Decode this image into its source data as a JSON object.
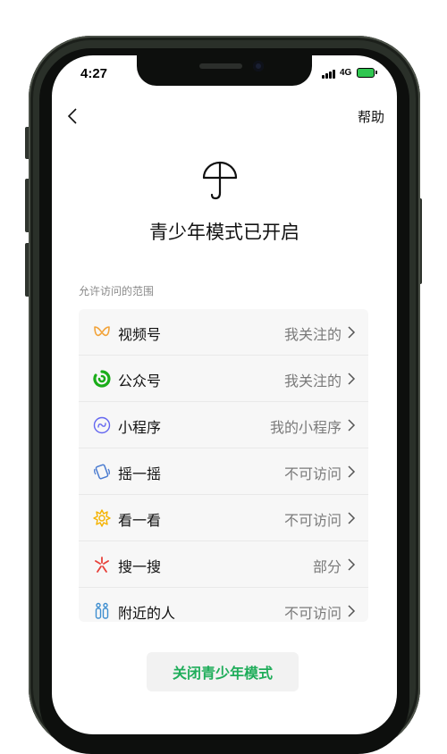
{
  "status_bar": {
    "time": "4:27",
    "network": "4G"
  },
  "nav": {
    "help_label": "帮助"
  },
  "hero": {
    "title": "青少年模式已开启"
  },
  "section_label": "允许访问的范围",
  "list_items": [
    {
      "label": "视频号",
      "value": "我关注的",
      "icon": "channels-icon",
      "color": "#f2a33a"
    },
    {
      "label": "公众号",
      "value": "我关注的",
      "icon": "official-accounts-icon",
      "color": "#1aad19"
    },
    {
      "label": "小程序",
      "value": "我的小程序",
      "icon": "mini-program-icon",
      "color": "#6467f0"
    },
    {
      "label": "摇一摇",
      "value": "不可访问",
      "icon": "shake-icon",
      "color": "#4a7bd0"
    },
    {
      "label": "看一看",
      "value": "不可访问",
      "icon": "top-stories-icon",
      "color": "#f5b300"
    },
    {
      "label": "搜一搜",
      "value": "部分",
      "icon": "search-icon",
      "color": "#e8413a"
    },
    {
      "label": "附近的人",
      "value": "不可访问",
      "icon": "people-nearby-icon",
      "color": "#3e8ed0"
    }
  ],
  "close_button_label": "关闭青少年模式",
  "colors": {
    "accent_green": "#1fad5a",
    "phone_frame": "#2a3029"
  }
}
